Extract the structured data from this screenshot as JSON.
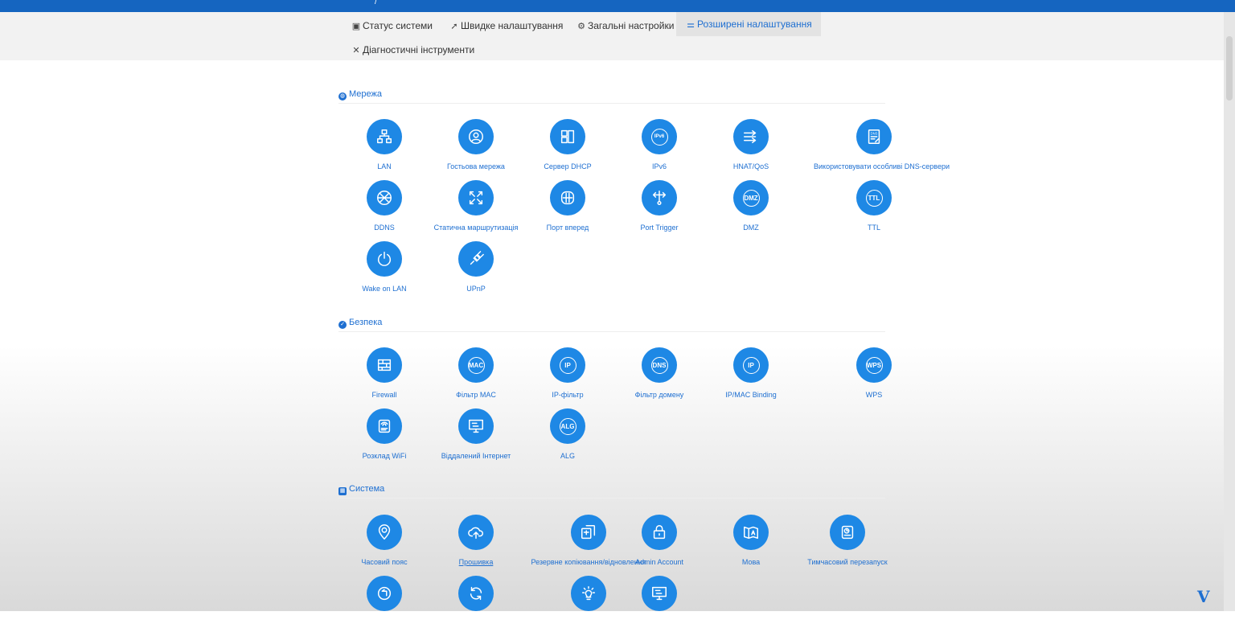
{
  "nav": {
    "tabs": [
      {
        "label": "Статус системи",
        "icon": "monitor-icon"
      },
      {
        "label": "Швидке налаштування",
        "icon": "rocket-icon"
      },
      {
        "label": "Загальні настройки",
        "icon": "gear-icon"
      },
      {
        "label": "Розширені налаштування",
        "icon": "sliders-icon",
        "active": true
      },
      {
        "label": "Діагностичні інструменти",
        "icon": "tools-icon"
      }
    ]
  },
  "sections": {
    "network": {
      "title": "Мережа",
      "icon": "globe-icon"
    },
    "security": {
      "title": "Безпека",
      "icon": "shield-icon"
    },
    "system": {
      "title": "Система",
      "icon": "grid-icon"
    }
  },
  "network_items": [
    {
      "label": "LAN",
      "icon": "lan-icon"
    },
    {
      "label": "Гостьова мережа",
      "icon": "guest-user-icon"
    },
    {
      "label": "Сервер DHCP",
      "icon": "dhcp-icon"
    },
    {
      "label": "IPv6",
      "icon": "ipv6-icon",
      "badge": "IPv6"
    },
    {
      "label": "HNAT/QoS",
      "icon": "arrows-icon"
    },
    {
      "label": "Використовувати особливі DNS-сервери",
      "icon": "dns-doc-icon"
    },
    {
      "label": "DDNS",
      "icon": "ddns-icon"
    },
    {
      "label": "Статична маршрутизація",
      "icon": "route-icon"
    },
    {
      "label": "Порт вперед",
      "icon": "port-forward-icon"
    },
    {
      "label": "Port Trigger",
      "icon": "trigger-icon"
    },
    {
      "label": "DMZ",
      "icon": "dmz-icon",
      "badge": "DMZ"
    },
    {
      "label": "TTL",
      "icon": "ttl-icon",
      "badge": "TTL"
    },
    {
      "label": "Wake on LAN",
      "icon": "power-icon"
    },
    {
      "label": "UPnP",
      "icon": "plug-icon"
    }
  ],
  "security_items": [
    {
      "label": "Firewall",
      "icon": "firewall-icon"
    },
    {
      "label": "Фільтр MAC",
      "icon": "mac-icon",
      "badge": "MAC"
    },
    {
      "label": "IP-фільтр",
      "icon": "ip-icon",
      "badge": "IP"
    },
    {
      "label": "Фільтр домену",
      "icon": "dns-icon",
      "badge": "DNS"
    },
    {
      "label": "IP/MAC Binding",
      "icon": "ip-mac-binding-icon",
      "badge": "IP"
    },
    {
      "label": "WPS",
      "icon": "wps-icon",
      "badge": "WPS"
    },
    {
      "label": "Розклад WiFi",
      "icon": "wifi-schedule-icon"
    },
    {
      "label": "Віддалений Інтернет",
      "icon": "remote-monitor-icon"
    },
    {
      "label": "ALG",
      "icon": "alg-icon",
      "badge": "ALG"
    }
  ],
  "system_items": [
    {
      "label": "Часовий пояс",
      "icon": "location-clock-icon"
    },
    {
      "label": "Прошивка",
      "icon": "cloud-upload-icon"
    },
    {
      "label": "Резервне копіювання/відновлення",
      "icon": "backup-icon"
    },
    {
      "label": "Admin Account",
      "icon": "lock-icon"
    },
    {
      "label": "Мова",
      "icon": "language-icon"
    },
    {
      "label": "Тимчасовий перезапуск",
      "icon": "timed-reboot-icon"
    },
    {
      "label": "",
      "icon": "restore-icon"
    },
    {
      "label": "",
      "icon": "refresh-icon"
    },
    {
      "label": "",
      "icon": "bulb-icon"
    },
    {
      "label": "",
      "icon": "monitor-icon"
    }
  ],
  "colors": {
    "accent": "#1e88e5",
    "link": "#1e6fd1",
    "topbar": "#1565c0"
  }
}
